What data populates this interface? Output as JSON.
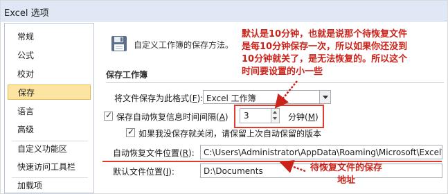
{
  "window": {
    "title": "Excel 选项"
  },
  "sidebar": {
    "items": [
      {
        "label": "常规"
      },
      {
        "label": "公式"
      },
      {
        "label": "校对"
      },
      {
        "label": "保存",
        "selected": true
      },
      {
        "label": "语言"
      },
      {
        "label": "高级"
      },
      {
        "label": "自定义功能区"
      },
      {
        "label": "快速访问工具栏"
      },
      {
        "label": "加载项"
      }
    ]
  },
  "main": {
    "header_text": "自定义工作簿的保存方法。",
    "section_title": "保存工作簿",
    "format_label": "将文件保存为此格式(",
    "format_key": "F",
    "format_value": "Excel 工作簿",
    "autorecover_label": "保存自动恢复信息时间间隔(",
    "autorecover_key": "A",
    "autorecover_value": "3",
    "minutes_label": "分钟(",
    "minutes_key": "M",
    "keep_last_label": "如果我没保存就关闭，请保留上次自动保留的版本",
    "autorecover_location_label": "自动恢复文件位置(",
    "autorecover_location_key": "R",
    "autorecover_location_value": "C:\\Users\\Administrator\\AppData\\Roaming\\Microsoft\\Excel\\",
    "default_location_label": "默认文件位置(",
    "default_location_key": "I",
    "default_location_value": "D:\\Documents",
    "icons": {
      "save": "floppy-disk-icon"
    }
  },
  "annotations": {
    "top_lines": [
      "默认是10分钟，也就是说那个待恢复文件",
      "是每10分钟保存一次，所以如果你还没到",
      "10分钟就关了，是无法恢复的。所以这个",
      "时间要设置的小一些"
    ],
    "bottom_lines": [
      "待恢复文件的保存",
      "地址"
    ],
    "color": "#c9231a"
  }
}
